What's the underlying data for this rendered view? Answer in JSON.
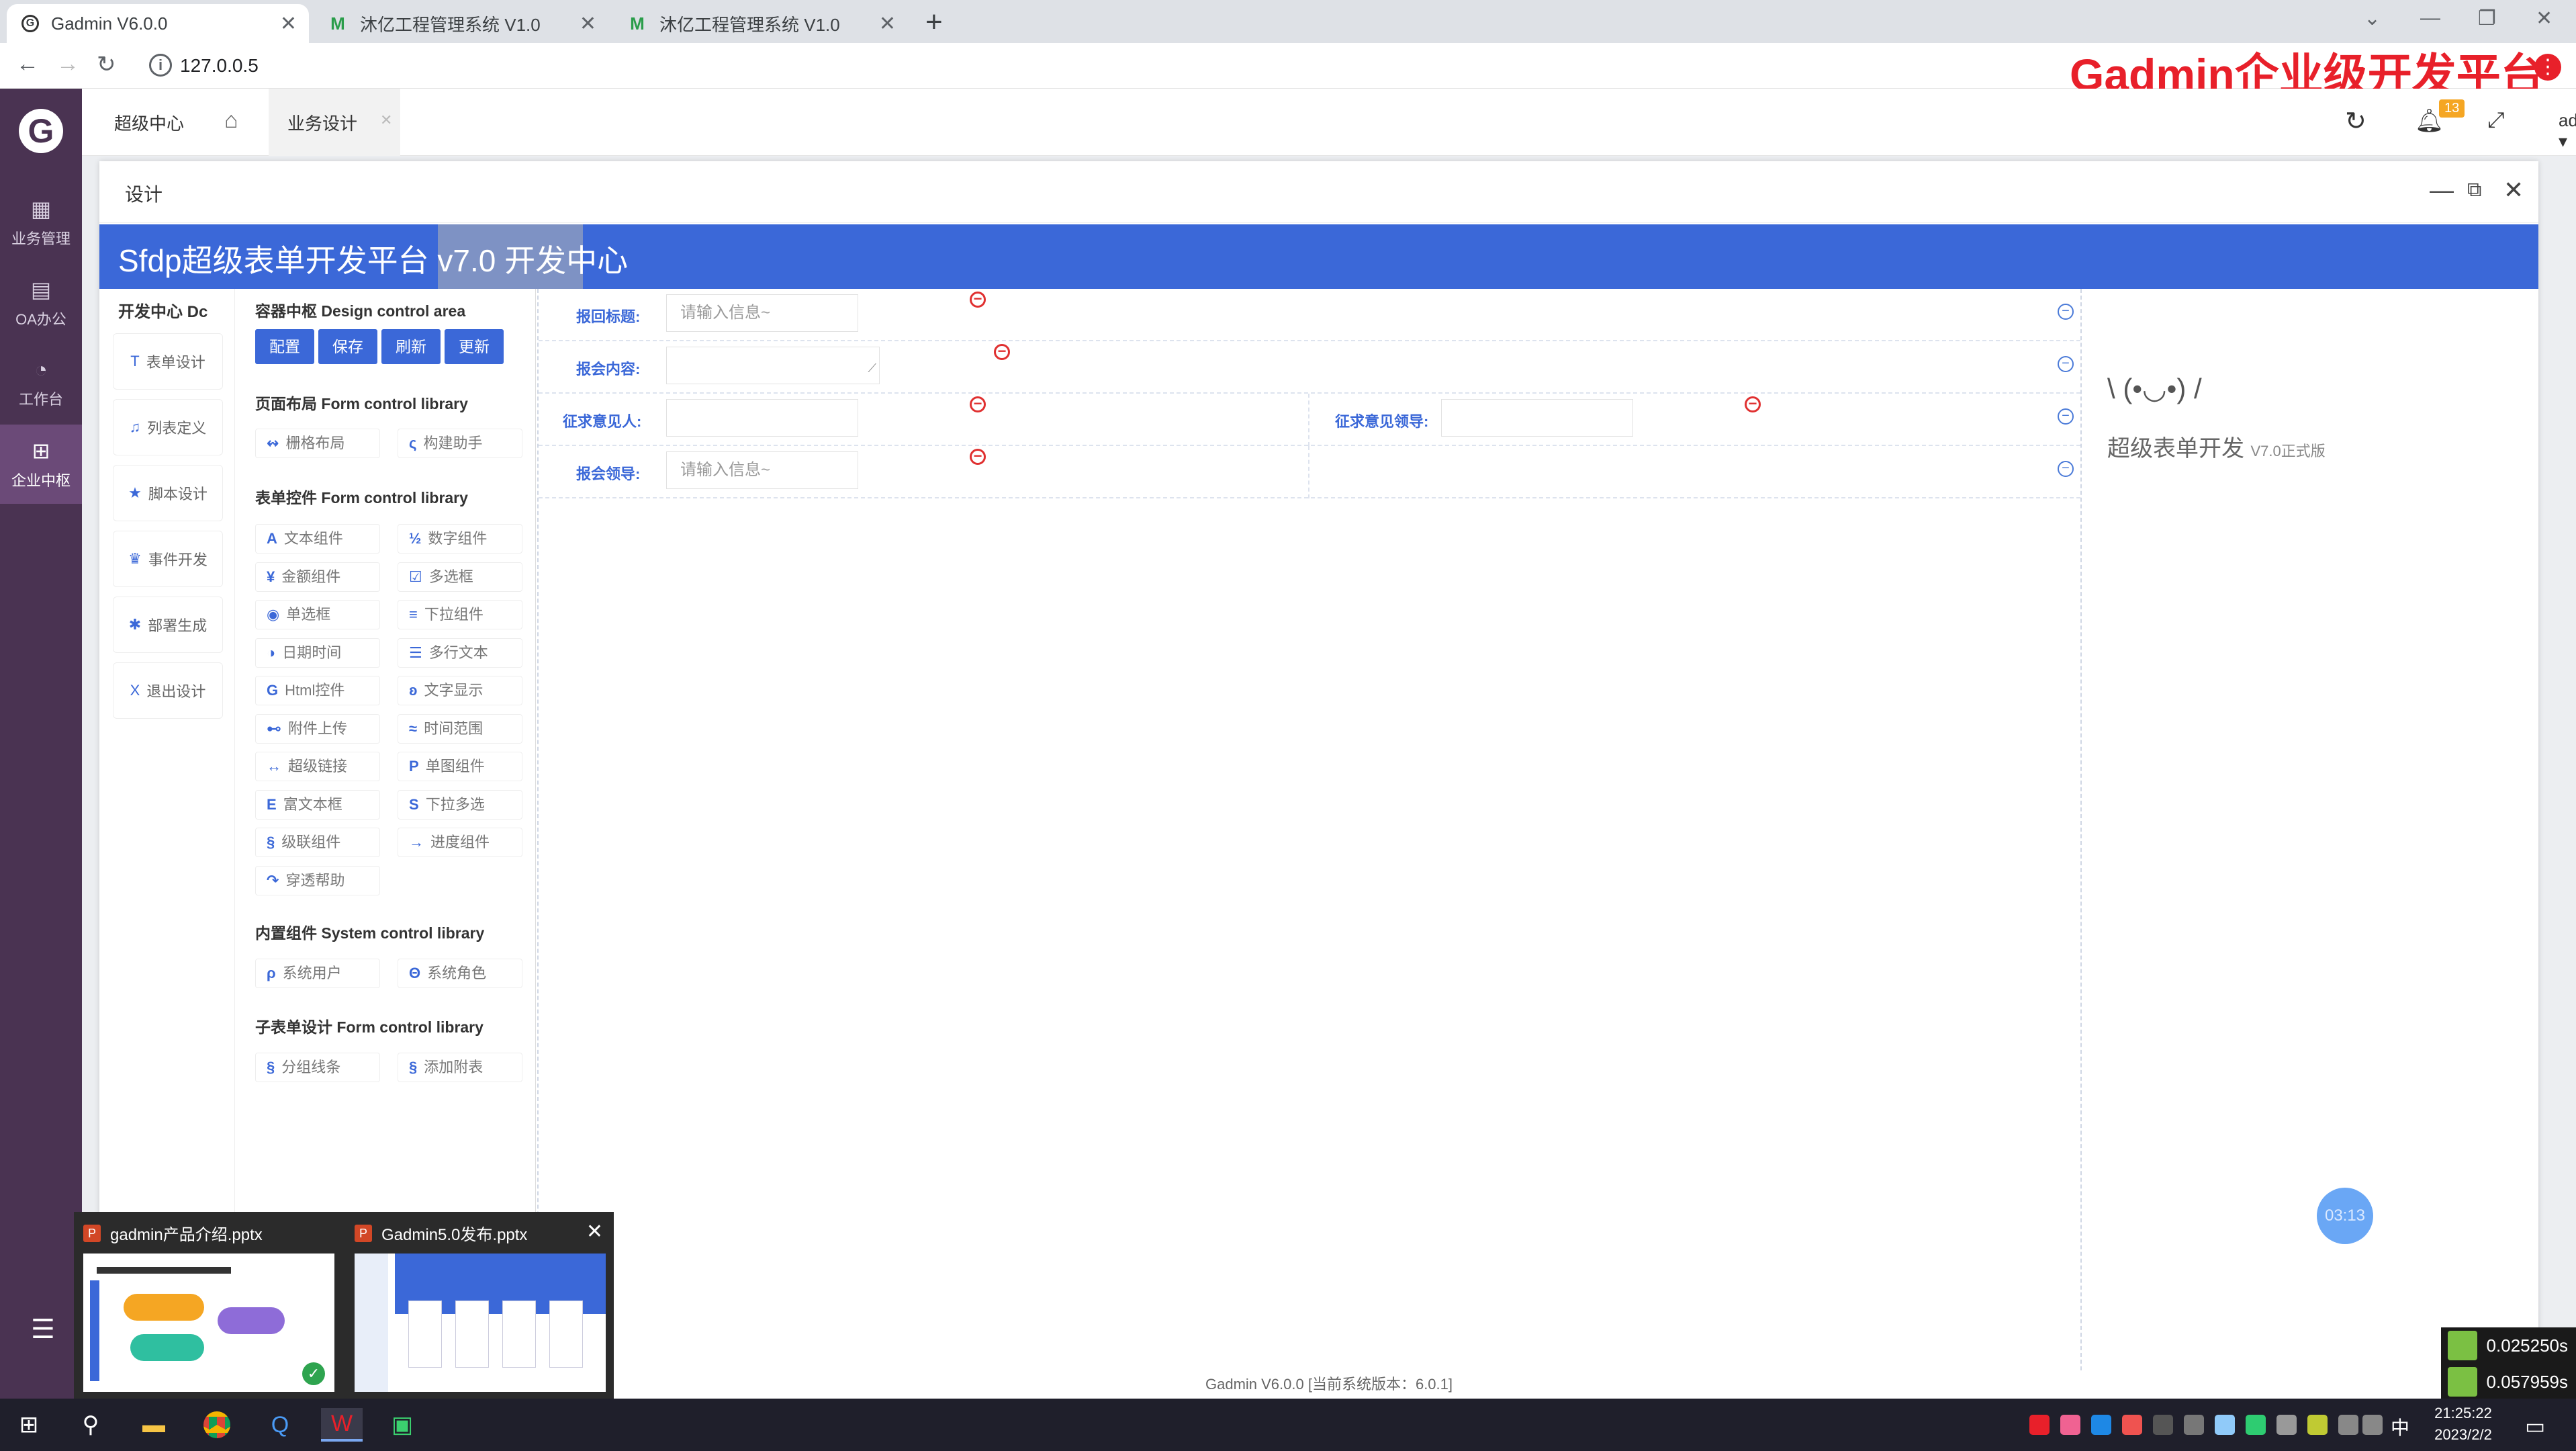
{
  "browser": {
    "tabs": [
      {
        "title": "Gadmin V6.0.0",
        "icon": "gadmin-favicon"
      },
      {
        "title": "沐亿工程管理系统 V1.0",
        "icon": "m-favicon"
      },
      {
        "title": "沐亿工程管理系统 V1.0",
        "icon": "m-favicon"
      }
    ],
    "url": "127.0.0.5",
    "brand_overlay": "Gadmin企业级开发平台"
  },
  "sidebar": {
    "items": [
      {
        "label": "业务管理",
        "icon": "grid-icon"
      },
      {
        "label": "OA办公",
        "icon": "document-icon"
      },
      {
        "label": "工作台",
        "icon": "dashboard-icon"
      },
      {
        "label": "企业中枢",
        "icon": "apps-icon"
      }
    ]
  },
  "header": {
    "tabs": [
      "超级中心",
      "业务设计"
    ],
    "notification_count": "13",
    "user": "admin"
  },
  "dialog": {
    "title": "设计",
    "banner": "Sfdp超级表单开发平台 v7.0 开发中心"
  },
  "dev_nav": {
    "title": "开发中心 Dc",
    "items": [
      {
        "label": "表单设计",
        "icon": "T"
      },
      {
        "label": "列表定义",
        "icon": "♫"
      },
      {
        "label": "脚本设计",
        "icon": "★"
      },
      {
        "label": "事件开发",
        "icon": "♛"
      },
      {
        "label": "部署生成",
        "icon": "✱"
      },
      {
        "label": "退出设计",
        "icon": "X"
      }
    ]
  },
  "library": {
    "design_title": "容器中枢 Design control area",
    "buttons": [
      "配置",
      "保存",
      "刷新",
      "更新"
    ],
    "layout_title": "页面布局 Form control library",
    "layout_items": [
      {
        "label": "栅格布局",
        "icon": "↭"
      },
      {
        "label": "构建助手",
        "icon": "ς"
      }
    ],
    "form_title": "表单控件 Form control library",
    "form_items": [
      {
        "label": "文本组件",
        "icon": "A"
      },
      {
        "label": "数字组件",
        "icon": "½"
      },
      {
        "label": "金额组件",
        "icon": "¥"
      },
      {
        "label": "多选框",
        "icon": "☑"
      },
      {
        "label": "单选框",
        "icon": "◉"
      },
      {
        "label": "下拉组件",
        "icon": "≡"
      },
      {
        "label": "日期时间",
        "icon": "◑"
      },
      {
        "label": "多行文本",
        "icon": "☰"
      },
      {
        "label": "Html控件",
        "icon": "G"
      },
      {
        "label": "文字显示",
        "icon": "ʚ"
      },
      {
        "label": "附件上传",
        "icon": "⊷"
      },
      {
        "label": "时间范围",
        "icon": "≈"
      },
      {
        "label": "超级链接",
        "icon": "↔"
      },
      {
        "label": "单图组件",
        "icon": "P"
      },
      {
        "label": "富文本框",
        "icon": "E"
      },
      {
        "label": "下拉多选",
        "icon": "S"
      },
      {
        "label": "级联组件",
        "icon": "§"
      },
      {
        "label": "进度组件",
        "icon": "→"
      },
      {
        "label": "穿透帮助",
        "icon": "↷"
      }
    ],
    "system_title": "内置组件 System control library",
    "system_items": [
      {
        "label": "系统用户",
        "icon": "ρ"
      },
      {
        "label": "系统角色",
        "icon": "Θ"
      }
    ],
    "subform_title": "子表单设计 Form control library",
    "subform_items": [
      {
        "label": "分组线条",
        "icon": "§"
      },
      {
        "label": "添加附表",
        "icon": "§"
      }
    ]
  },
  "form": {
    "rows": [
      {
        "fields": [
          {
            "label": "报回标题:",
            "placeholder": "请输入信息~"
          }
        ]
      },
      {
        "fields": [
          {
            "label": "报会内容:",
            "placeholder": ""
          }
        ]
      },
      {
        "fields": [
          {
            "label": "征求意见人:",
            "placeholder": ""
          },
          {
            "label": "征求意见领导:",
            "placeholder": ""
          }
        ]
      },
      {
        "fields": [
          {
            "label": "报会领导:",
            "placeholder": "请输入信息~"
          }
        ]
      }
    ]
  },
  "right_panel": {
    "emoticon": "\\ (•◡•) /",
    "title": "超级表单开发",
    "version": "V7.0正式版",
    "timer": "03:13"
  },
  "footer": "Gadmin V6.0.0 [当前系统版本：6.0.1]",
  "thumbnails": [
    {
      "title": "gadmin产品介绍.pptx"
    },
    {
      "title": "Gadmin5.0发布.pptx"
    }
  ],
  "perf": [
    "0.025250s",
    "0.057959s"
  ],
  "taskbar": {
    "ime": "中",
    "time": "21:25:22",
    "date": "2023/2/2"
  },
  "colors": {
    "accent": "#3b68d8",
    "sidebar": "#4a3352",
    "brand_red": "#e8202a"
  }
}
